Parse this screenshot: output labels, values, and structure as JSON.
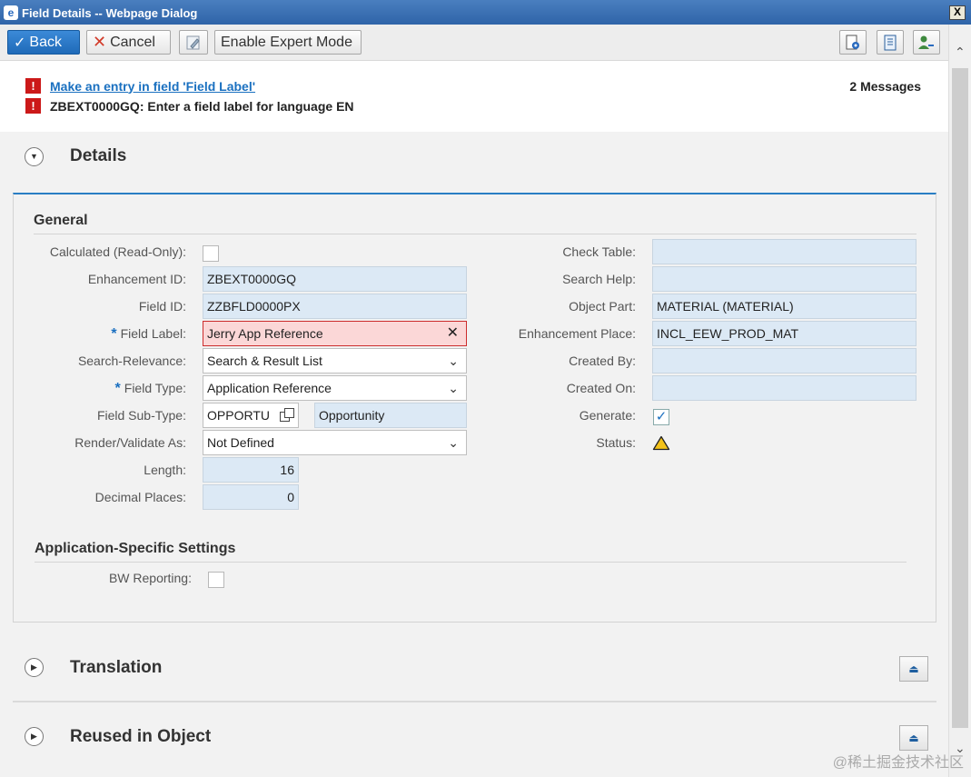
{
  "window": {
    "title": "Field Details -- Webpage Dialog",
    "close_glyph": "X"
  },
  "toolbar": {
    "back_label": "Back",
    "cancel_label": "Cancel",
    "expert_label": "Enable Expert Mode"
  },
  "messages": {
    "link_text": "Make an entry in field 'Field Label'",
    "second_text": "ZBEXT0000GQ: Enter a field label for language EN",
    "count_text": "2 Messages",
    "error_glyph": "!"
  },
  "details": {
    "title": "Details",
    "general_title": "General",
    "left": {
      "calculated_label": "Calculated (Read-Only):",
      "enhancement_id_label": "Enhancement ID:",
      "enhancement_id_value": "ZBEXT0000GQ",
      "field_id_label": "Field ID:",
      "field_id_value": "ZZBFLD0000PX",
      "field_label_label": "Field Label:",
      "field_label_value": "Jerry App Reference",
      "search_rel_label": "Search-Relevance:",
      "search_rel_value": "Search & Result List",
      "field_type_label": "Field Type:",
      "field_type_value": "Application Reference",
      "sub_type_label": "Field Sub-Type:",
      "sub_type_value": "OPPORTU",
      "sub_type_desc": "Opportunity",
      "render_label": "Render/Validate As:",
      "render_value": "Not Defined",
      "length_label": "Length:",
      "length_value": "16",
      "decimal_label": "Decimal Places:",
      "decimal_value": "0",
      "required_mark": "*"
    },
    "right": {
      "check_table_label": "Check Table:",
      "search_help_label": "Search Help:",
      "object_part_label": "Object Part:",
      "object_part_value": "MATERIAL (MATERIAL)",
      "enh_place_label": "Enhancement Place:",
      "enh_place_value": "INCL_EEW_PROD_MAT",
      "created_by_label": "Created By:",
      "created_on_label": "Created On:",
      "generate_label": "Generate:",
      "status_label": "Status:"
    },
    "app_settings_title": "Application-Specific Settings",
    "bw_label": "BW Reporting:"
  },
  "translation": {
    "title": "Translation"
  },
  "reused": {
    "title": "Reused in Object"
  },
  "glyphs": {
    "clear": "✕",
    "dropdown": "⌄",
    "check": "✓",
    "toggle_open": "▼",
    "toggle_closed": "▶",
    "collapse": "⏏"
  },
  "watermark": "@稀土掘金技术社区",
  "colors": {
    "accent": "#2a7ec4",
    "error": "#cc1919",
    "primary_button": "#1f6ab8"
  }
}
